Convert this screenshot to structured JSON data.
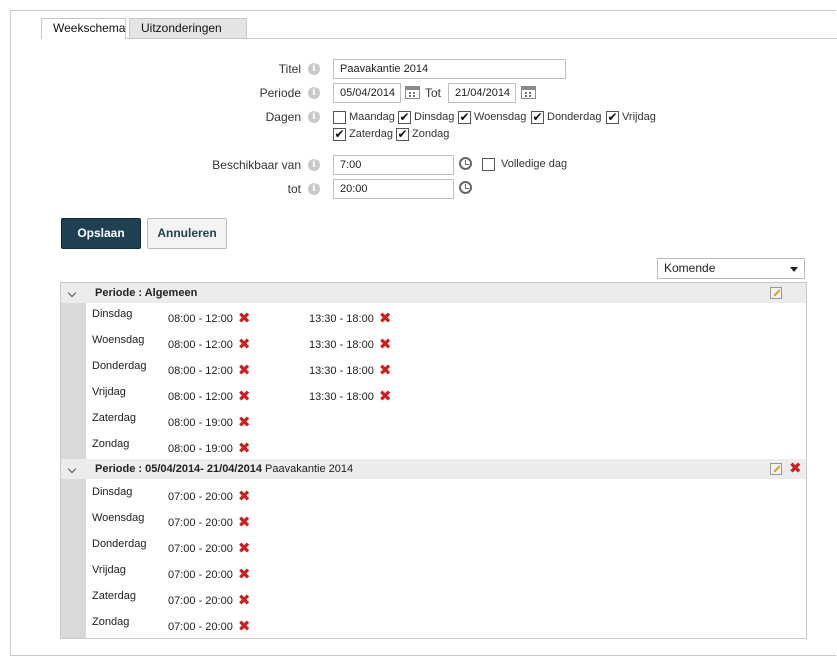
{
  "tabs": {
    "weekschema": "Weekschema",
    "uitzonderingen": "Uitzonderingen"
  },
  "form": {
    "titel_label": "Titel",
    "titel_value": "Paavakantie 2014",
    "periode_label": "Periode",
    "periode_from": "05/04/2014",
    "tot_inline_label": "Tot",
    "periode_to": "21/04/2014",
    "dagen_label": "Dagen",
    "days": [
      {
        "label": "Maandag",
        "checked": false
      },
      {
        "label": "Dinsdag",
        "checked": true
      },
      {
        "label": "Woensdag",
        "checked": true
      },
      {
        "label": "Donderdag",
        "checked": true
      },
      {
        "label": "Vrijdag",
        "checked": true
      },
      {
        "label": "Zaterdag",
        "checked": true
      },
      {
        "label": "Zondag",
        "checked": true
      }
    ],
    "beschikbaar_label": "Beschikbaar van",
    "van_value": "7:00",
    "volledige_dag_label": "Volledige dag",
    "volledige_dag_checked": false,
    "tot_label": "tot",
    "tot_value": "20:00",
    "info_glyph": "i",
    "check_glyph": "✔"
  },
  "buttons": {
    "save": "Opslaan",
    "cancel": "Annuleren"
  },
  "filter": {
    "selected": "Komende"
  },
  "delete_glyph": "✖",
  "periods": [
    {
      "prefix": "Periode : Algemeen",
      "name": "",
      "rows": [
        {
          "day": "Dinsdag",
          "slots": [
            "08:00 - 12:00",
            "13:30 - 18:00"
          ]
        },
        {
          "day": "Woensdag",
          "slots": [
            "08:00 - 12:00",
            "13:30 - 18:00"
          ]
        },
        {
          "day": "Donderdag",
          "slots": [
            "08:00 - 12:00",
            "13:30 - 18:00"
          ]
        },
        {
          "day": "Vrijdag",
          "slots": [
            "08:00 - 12:00",
            "13:30 - 18:00"
          ]
        },
        {
          "day": "Zaterdag",
          "slots": [
            "08:00 - 19:00"
          ]
        },
        {
          "day": "Zondag",
          "slots": [
            "08:00 - 19:00"
          ]
        }
      ]
    },
    {
      "prefix": "Periode : 05/04/2014- 21/04/2014",
      "name": "Paavakantie 2014",
      "rows": [
        {
          "day": "Dinsdag",
          "slots": [
            "07:00 - 20:00"
          ]
        },
        {
          "day": "Woensdag",
          "slots": [
            "07:00 - 20:00"
          ]
        },
        {
          "day": "Donderdag",
          "slots": [
            "07:00 - 20:00"
          ]
        },
        {
          "day": "Vrijdag",
          "slots": [
            "07:00 - 20:00"
          ]
        },
        {
          "day": "Zaterdag",
          "slots": [
            "07:00 - 20:00"
          ]
        },
        {
          "day": "Zondag",
          "slots": [
            "07:00 - 20:00"
          ]
        }
      ]
    }
  ]
}
